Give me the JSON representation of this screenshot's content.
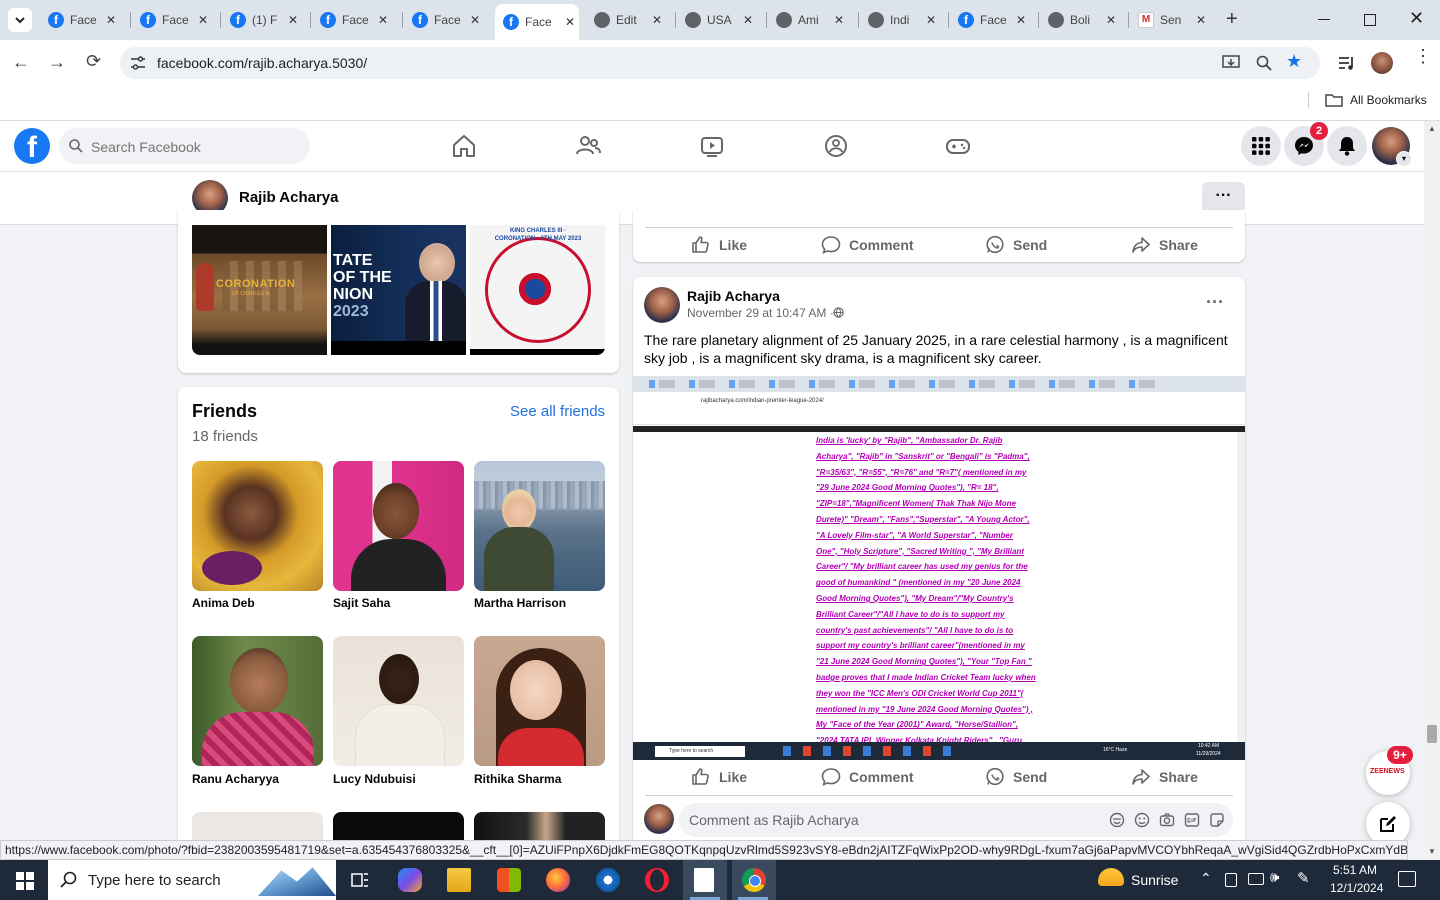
{
  "browser": {
    "tabs": [
      {
        "label": "Face",
        "icon": "facebook-icon"
      },
      {
        "label": "Face",
        "icon": "facebook-icon"
      },
      {
        "label": "(1) F",
        "icon": "facebook-icon"
      },
      {
        "label": "Face",
        "icon": "facebook-icon"
      },
      {
        "label": "Face",
        "icon": "facebook-icon"
      },
      {
        "label": "Face",
        "icon": "facebook-icon",
        "active": true
      },
      {
        "label": "Edit",
        "icon": "globe-icon"
      },
      {
        "label": "USA",
        "icon": "globe-icon"
      },
      {
        "label": "Ami",
        "icon": "globe-icon"
      },
      {
        "label": "Indi",
        "icon": "globe-icon"
      },
      {
        "label": "Face",
        "icon": "facebook-icon"
      },
      {
        "label": "Boli",
        "icon": "globe-icon"
      },
      {
        "label": "Sen",
        "icon": "gmail-icon"
      }
    ],
    "url": "facebook.com/rajib.acharya.5030/",
    "bookmarks_label": "All Bookmarks",
    "status_url": "https://www.facebook.com/photo/?fbid=2382003595481719&set=a.635454376803325&__cft__[0]=AZUiFPnpX6DjdkFmEG8QOTKqnpqUzvRlmd5S923vSY8-eBdn2jAITZFqWixPp2OD-why9RDgL-fxum7aGj6aPapvMVCOYbhReqaA_wVgiSid4QGZrdbHoPxCxmYdBHXlm..."
  },
  "facebook": {
    "search_placeholder": "Search Facebook",
    "messenger_badge": "2",
    "profile_name": "Rajib Acharya",
    "more_dots": "···"
  },
  "photos": {
    "coronation_text": "CORONATION",
    "coronation_sub": "OF CHARLES III",
    "state_text": [
      "TATE",
      "OF THE",
      "NION",
      "2023"
    ],
    "seal_text": "KING CHARLES III · CORONATION · 6TH MAY 2023"
  },
  "friends": {
    "title": "Friends",
    "see_all": "See all friends",
    "count": "18 friends",
    "list": [
      {
        "name": "Anima Deb"
      },
      {
        "name": "Sajit Saha"
      },
      {
        "name": "Martha Harrison"
      },
      {
        "name": "Ranu Acharyya"
      },
      {
        "name": "Lucy Ndubuisi"
      },
      {
        "name": "Rithika Sharma"
      }
    ]
  },
  "actions": {
    "like": "Like",
    "comment": "Comment",
    "send": "Send",
    "share": "Share"
  },
  "post": {
    "author": "Rajib Acharya",
    "date": "November 29 at 10:47 AM · ",
    "text": "The rare planetary alignment of 25 January 2025, in a rare celestial harmony , is a magnificent   sky job , is a magnificent sky drama, is a magnificent sky career.",
    "screenshot_url": "rajibacharya.com/indian-premier-league-2024/",
    "screenshot_lines": [
      "India is 'lucky'  by \"Rajib\", \"Ambassador Dr. Rajib",
      "Acharya\", \"Rajib\" in \"Sanskrit\" or \"Bengali\" is \"Padma\",",
      "\"R=35/63\", \"R=55\", \"R=76\" and  \"R=7\"( mentioned in my",
      "\"29 June 2024 Good Morning Quotes\"), \"R= 18\",",
      "\"ZIP=18\",\"Magnificent Women( Thak Thak Nijo Mone",
      "Durete)\" \"Dream\", \"Fans\",\"Superstar\", \"A Young Actor\",",
      "\"A Lovely Film-star\", \"A  World Superstar\",  \"Number",
      "One\", \"Holy Scripture\", \"Sacred Writing \", \"My Brilliant",
      "Career\"/ \"My brilliant career has used my genius for the",
      "good of humankind \" (mentioned in my \"20 June 2024",
      "Good Morning Quotes\"), \"My Dream\"/\"My Country's",
      "Brilliant Career\"/\"All I have to do is to support my",
      "country's past achievements\"/ \"All I have to do is to",
      "support my country's brilliant career\"(mentioned in my",
      "\"21 June 2024 Good Morning Quotes\"), \"Your \"Top Fan \"",
      "badge proves that I made Indian Cricket Team lucky when",
      "they won the \"ICC Men's ODI Cricket World Cup 2011\"(",
      "mentioned in my \"19 June 2024 Good Morning Quotes\") ,",
      "My \"Face of the Year (2001)\" Award,   \"Horse/Stallion\",",
      "\"2024 TATA IPL Winner Kolkata Knight Riders\" , \"Guru"
    ],
    "inner_taskbar_search": "Type here to search",
    "inner_weather": "16°C Haze",
    "inner_time": "10:42 AM",
    "inner_date": "11/29/2024",
    "comment_placeholder": "Comment as Rajib Acharya"
  },
  "floating": {
    "news_badge": "9+",
    "news_label": "ZEENEWS"
  },
  "taskbar": {
    "search_placeholder": "Type here to search",
    "weather": "Sunrise",
    "time": "5:51 AM",
    "date": "12/1/2024"
  }
}
